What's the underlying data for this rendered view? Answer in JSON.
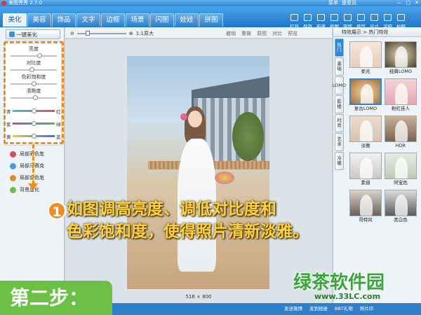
{
  "app": {
    "title": "美图秀秀 2.7.0",
    "menu": [
      "菜单",
      "提意见"
    ],
    "window_controls": [
      "—",
      "□",
      "✕"
    ]
  },
  "tabs": [
    "美化",
    "美容",
    "饰品",
    "文字",
    "边框",
    "场景",
    "闪图",
    "娃娃",
    "拼图"
  ],
  "active_tab": "美化",
  "tools": [
    "打开",
    "保存",
    "新建",
    "抠图",
    "旋转",
    "裁剪",
    "尺寸",
    "涂鸦",
    "拍照"
  ],
  "left_panel": {
    "onekey_label": "一键美化",
    "sliders": [
      {
        "label": "亮度",
        "value": 0.62
      },
      {
        "label": "对比度",
        "value": 0.45
      },
      {
        "label": "色彩饱和度",
        "value": 0.5
      },
      {
        "label": "清晰度",
        "value": 0.52
      }
    ],
    "color_sliders": [
      {
        "left": "青",
        "right": "红",
        "value": 0.5
      },
      {
        "left": "紫",
        "right": "绿",
        "value": 0.5
      },
      {
        "left": "黄",
        "right": "蓝",
        "value": 0.5
      }
    ],
    "tool_items": [
      "局部彩色笔",
      "局部马赛克",
      "局部变色笔",
      "背景虚化"
    ]
  },
  "canvas": {
    "zoom_label": "1:1原大",
    "edit_actions": [
      "撤销",
      "重做",
      "原图",
      "对比",
      "预览"
    ],
    "dimensions": "516 × 800"
  },
  "right_panel": {
    "header": "特效展示 > 热门特效",
    "vertical_tabs": [
      "热门",
      "基础",
      "LOMO",
      "影楼",
      "时尚",
      "艺术",
      "冷暖"
    ],
    "effects": [
      "柔光",
      "经典LOMO",
      "复古LOMO",
      "粉红佳人",
      "淡雅",
      "HDR",
      "素描",
      "阿宝色",
      "哥特风",
      "黑白色"
    ],
    "selected_effect": "复古LOMO"
  },
  "annotation": {
    "number": "1",
    "text_line1": "如图调高亮度、调低对比度和",
    "text_line2": "色彩饱和度，使得照片清新淡雅。"
  },
  "step_label": "第二步：",
  "status_bar": [
    "发送微博",
    "发到相册",
    "BBT礼物",
    "照片印"
  ],
  "watermark": {
    "name": "绿茶软件园",
    "url": "www.33LC.com"
  },
  "colors": {
    "accent": "#2e86d4",
    "annotation_orange": "#f28c1e",
    "annotation_text": "#ffd23c",
    "step_green": "#6cc046"
  }
}
